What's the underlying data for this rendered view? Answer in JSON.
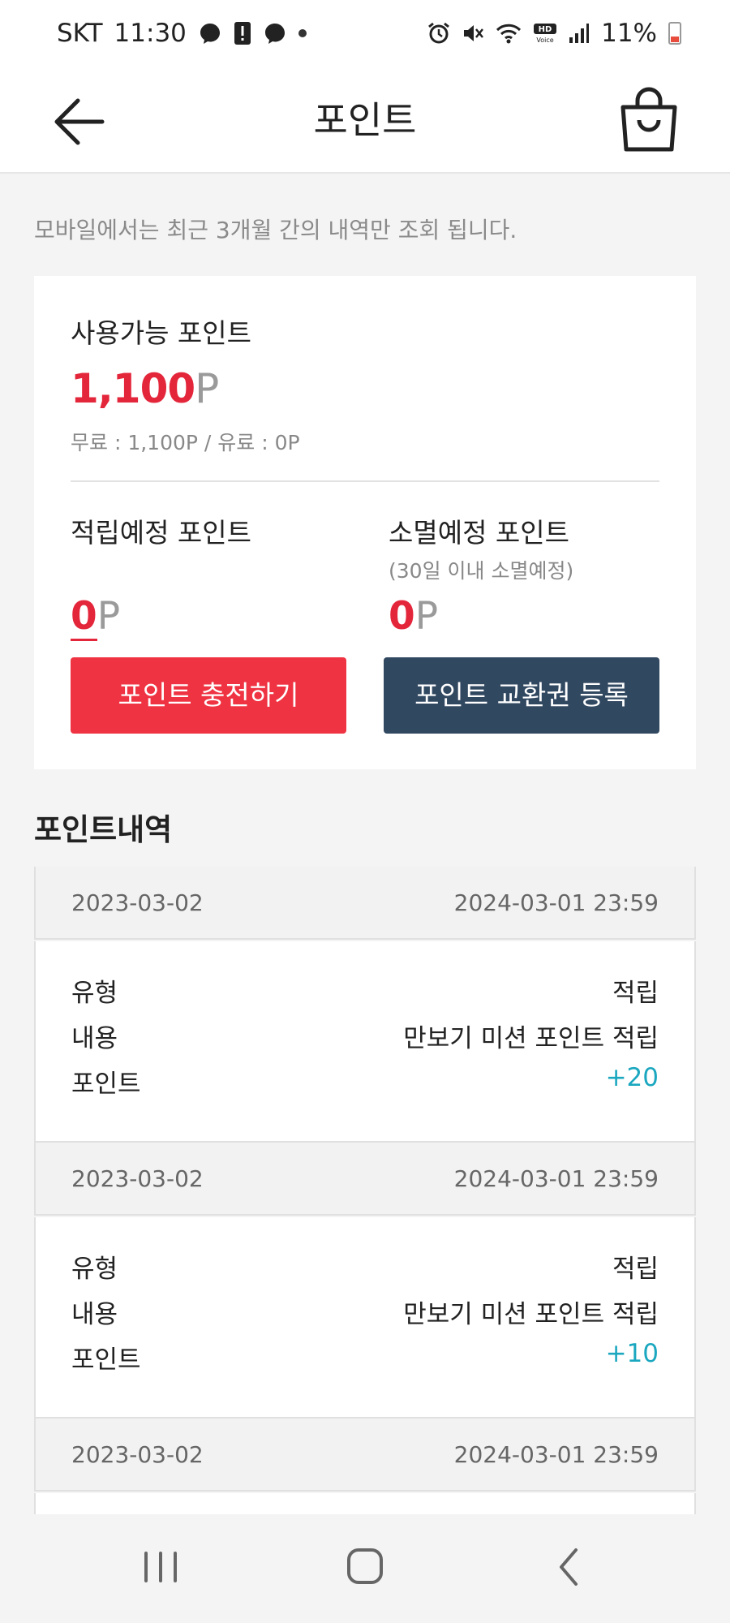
{
  "status_bar": {
    "carrier": "SKT",
    "time": "11:30",
    "battery": "11%",
    "left_icons": [
      "messenger-icon",
      "alert-icon",
      "messenger-icon"
    ],
    "right_icons": [
      "alarm-icon",
      "mute-icon",
      "wifi-icon",
      "hd-voice-icon",
      "signal-icon"
    ]
  },
  "header": {
    "title": "포인트",
    "back_icon": "back-arrow-icon",
    "cart_icon": "shopping-bag-icon"
  },
  "notice": "모바일에서는 최근 3개월 간의 내역만 조회 됩니다.",
  "summary": {
    "available_label": "사용가능 포인트",
    "available_value": "1,100",
    "unit": "P",
    "available_detail": "무료 : 1,100P / 유료 : 0P",
    "pending_label": "적립예정 포인트",
    "pending_value": "0",
    "expiring_label": "소멸예정 포인트",
    "expiring_sub": "(30일 이내 소멸예정)",
    "expiring_value": "0",
    "charge_button": "포인트 충전하기",
    "voucher_button": "포인트 교환권 등록"
  },
  "colors": {
    "accent_red": "#e4263b",
    "button_navy": "#314861",
    "plus_teal": "#1aa7bf"
  },
  "history": {
    "title": "포인트내역",
    "labels": {
      "type": "유형",
      "content": "내용",
      "points": "포인트"
    },
    "entries": [
      {
        "date": "2023-03-02",
        "expiry": "2024-03-01 23:59",
        "type": "적립",
        "content": "만보기 미션 포인트 적립",
        "points": "+20"
      },
      {
        "date": "2023-03-02",
        "expiry": "2024-03-01 23:59",
        "type": "적립",
        "content": "만보기 미션 포인트 적립",
        "points": "+10"
      },
      {
        "date": "2023-03-02",
        "expiry": "2024-03-01 23:59",
        "type": "",
        "content": "",
        "points": ""
      }
    ]
  },
  "nav": [
    "recents-icon",
    "home-icon",
    "back-icon"
  ]
}
